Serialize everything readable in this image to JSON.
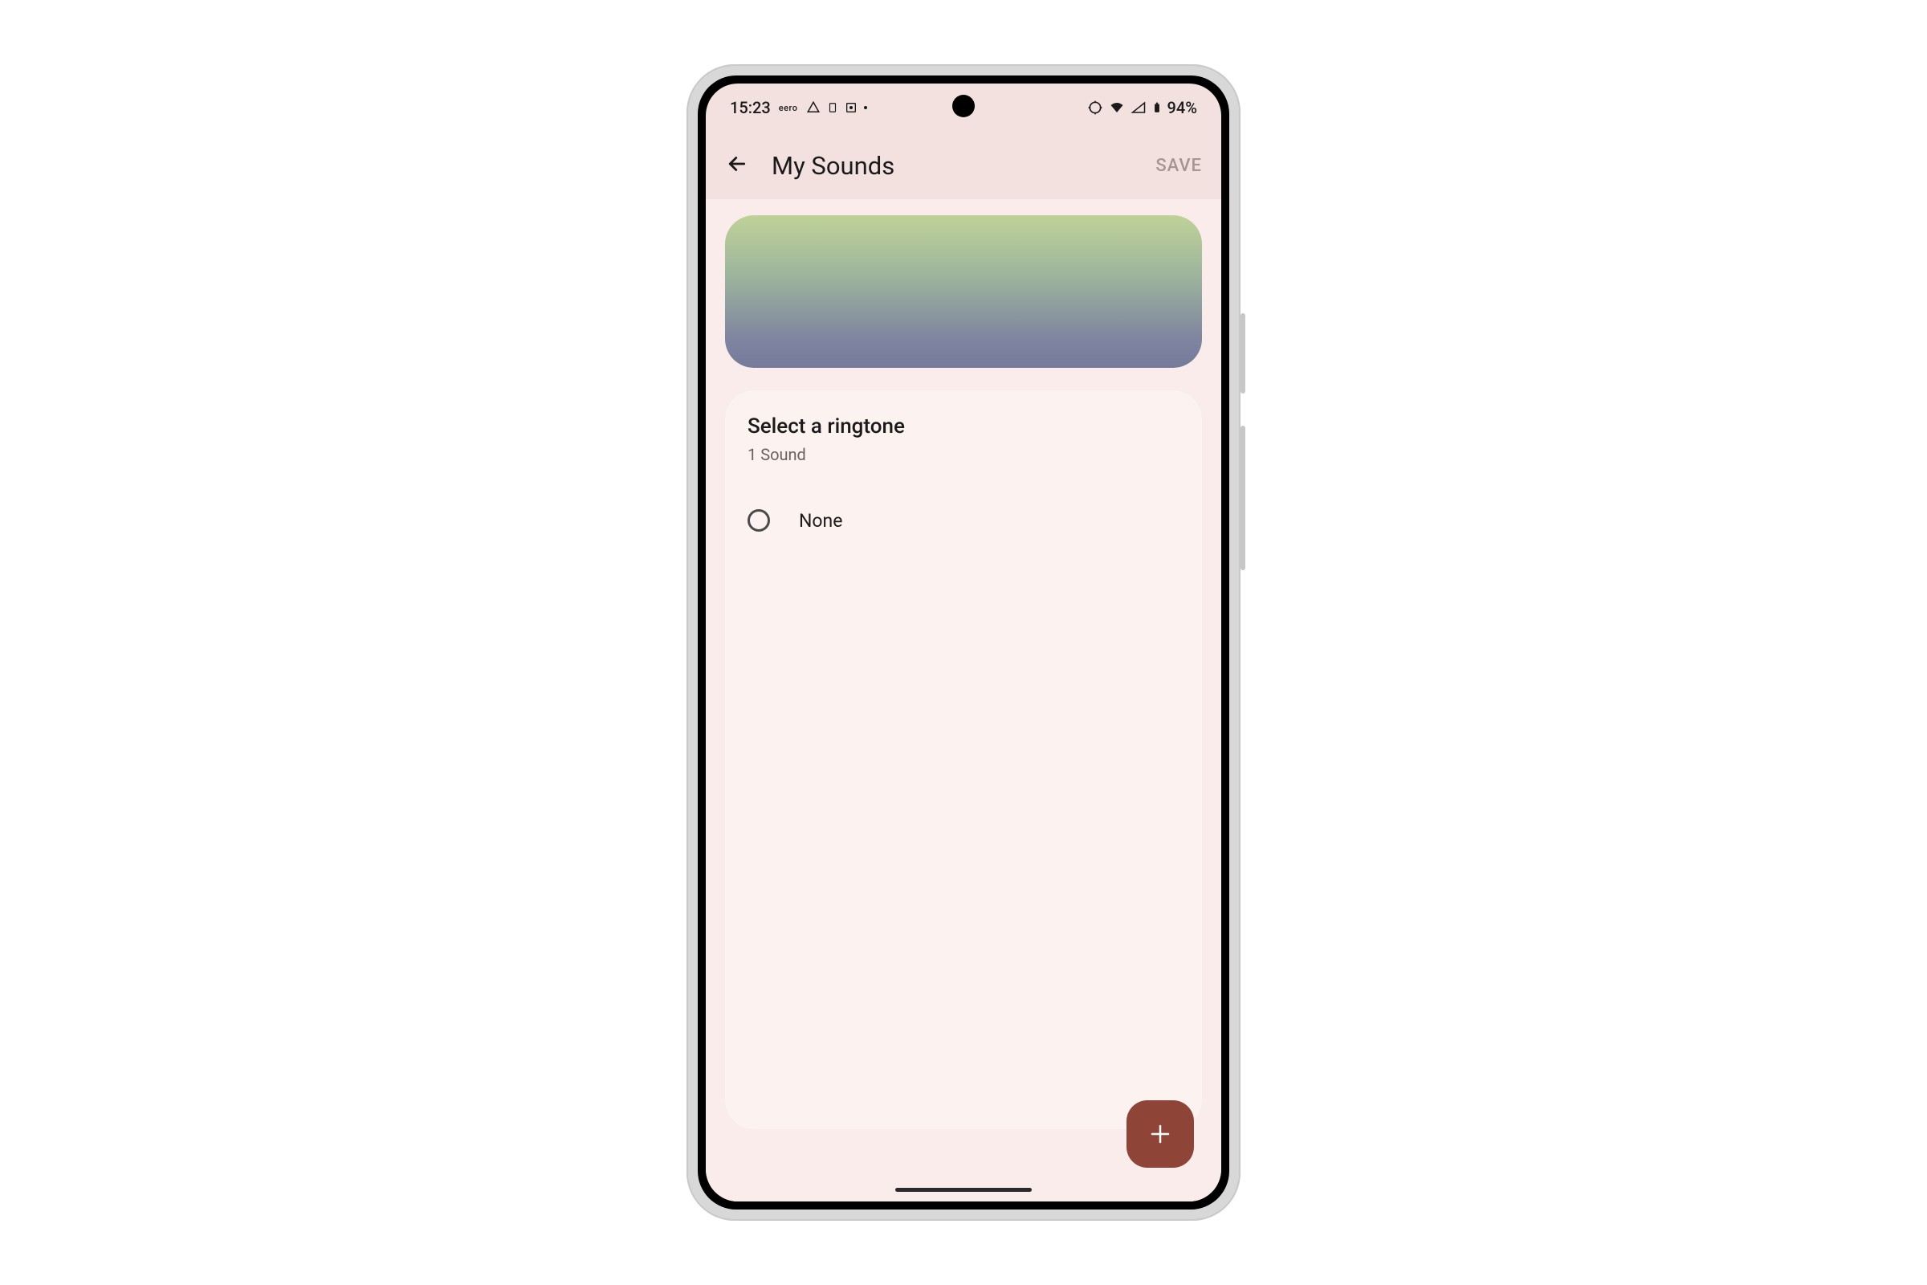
{
  "status": {
    "time": "15:23",
    "carrier": "eero",
    "battery": "94%"
  },
  "appbar": {
    "title": "My Sounds",
    "save_label": "SAVE"
  },
  "card": {
    "title": "Select a ringtone",
    "subtitle": "1 Sound"
  },
  "sounds": [
    {
      "label": "None"
    }
  ]
}
